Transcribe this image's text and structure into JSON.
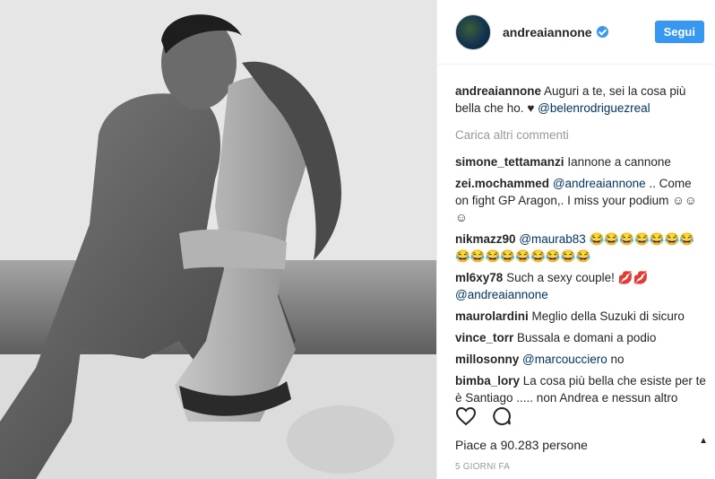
{
  "post": {
    "username": "andreaiannone",
    "follow_label": "Segui",
    "caption": {
      "user": "andreaiannone",
      "text": "Auguri a te, sei la cosa più bella che ho.",
      "heart": "♥",
      "mention": "@belenrodriguezreal"
    },
    "load_more": "Carica altri commenti",
    "comments": [
      {
        "user": "simone_tettamanzi",
        "pre": "",
        "mention": "",
        "text": "Iannone a cannone"
      },
      {
        "user": "zei.mochammed",
        "pre": "",
        "mention": "@andreaiannone",
        "text": ".. Come on fight GP Aragon,. I miss your podium ☺☺☺"
      },
      {
        "user": "nikmazz90",
        "pre": "",
        "mention": "@maurab83",
        "text": "😂😂😂😂😂😂😂😂😂😂😂😂😂😂😂😂"
      },
      {
        "user": "ml6xy78",
        "pre": "Such a sexy couple! 💋💋",
        "mention": "@andreaiannone",
        "text": ""
      },
      {
        "user": "maurolardini",
        "pre": "",
        "mention": "",
        "text": "Meglio della Suzuki di sicuro"
      },
      {
        "user": "vince_torr",
        "pre": "",
        "mention": "",
        "text": "Bussala e domani a podio"
      },
      {
        "user": "millosonny",
        "pre": "",
        "mention": "@marcoucciero",
        "text": "no"
      },
      {
        "user": "bimba_lory",
        "pre": "",
        "mention": "",
        "text": "La cosa più bella che esiste per te è Santiago ..... non Andrea e nessun altro"
      }
    ],
    "likes": "Piace a 90.283 persone",
    "time": "5 GIORNI FA"
  },
  "icons": {
    "like": "heart-outline-icon",
    "comment": "speech-bubble-icon",
    "verified": "verified-badge-icon"
  },
  "colors": {
    "accent": "#3897f0",
    "mention": "#003569",
    "muted": "#999999"
  }
}
